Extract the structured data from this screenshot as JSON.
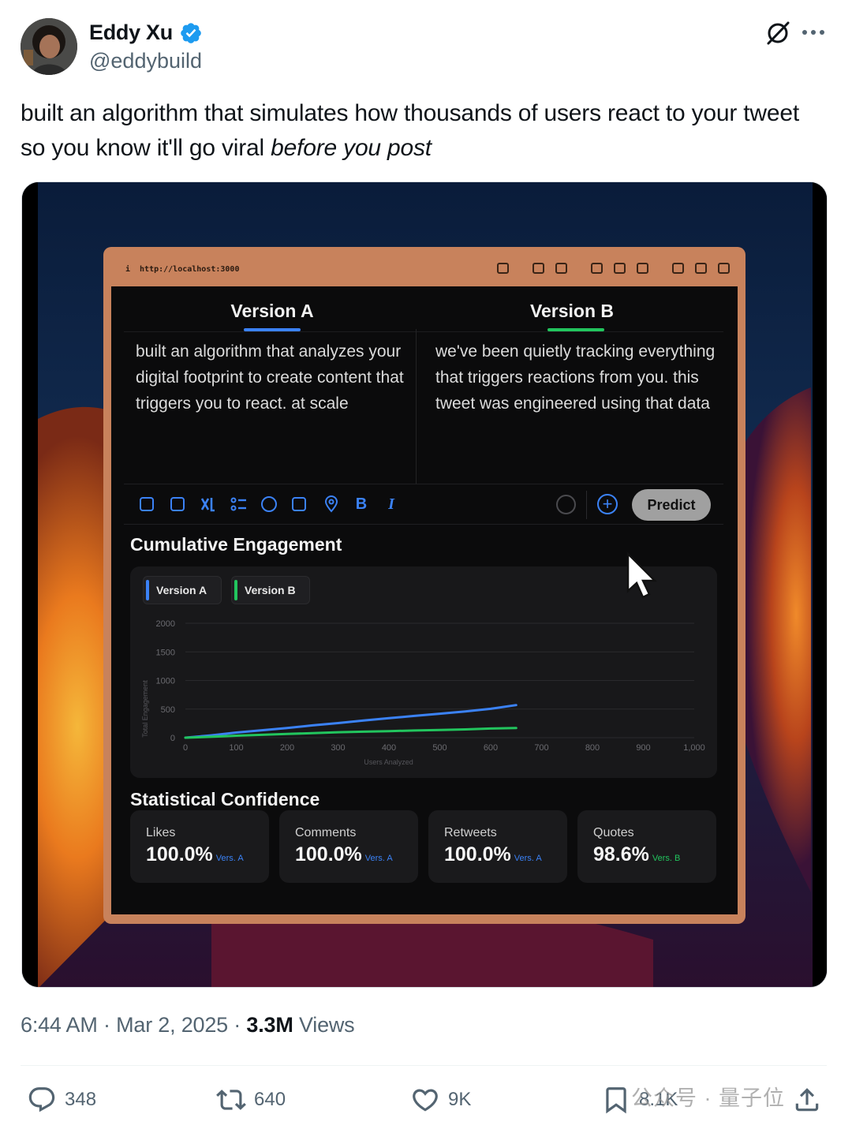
{
  "author": {
    "name": "Eddy Xu",
    "handle": "@eddybuild"
  },
  "tweet": {
    "text": "built an algorithm that simulates how thousands of users react to your tweet so you know it'll go viral ",
    "text_italic": "before you post"
  },
  "media": {
    "browser": {
      "info": "i",
      "url": "http://localhost:3000"
    },
    "tabs": {
      "a": "Version A",
      "b": "Version B"
    },
    "version_a_text": "built an algorithm that analyzes your digital footprint to create content that triggers you to react. at scale",
    "version_b_text": "we've been quietly tracking everything that triggers reactions from you. this tweet was engineered using that data",
    "toolbar": {
      "icons": [
        "image-icon",
        "gif-icon",
        "grok-icon",
        "list-icon",
        "emoji-icon",
        "schedule-icon",
        "location-icon",
        "bold-icon",
        "italic-icon"
      ],
      "bold": "B",
      "italic": "I",
      "add": "+",
      "predict_label": "Predict"
    },
    "engagement_title": "Cumulative Engagement",
    "confidence_title": "Statistical Confidence",
    "stats": [
      {
        "label": "Likes",
        "value": "100.0%",
        "version": "Vers. A"
      },
      {
        "label": "Comments",
        "value": "100.0%",
        "version": "Vers. A"
      },
      {
        "label": "Retweets",
        "value": "100.0%",
        "version": "Vers. A"
      },
      {
        "label": "Quotes",
        "value": "98.6%",
        "version": "Vers. B"
      }
    ]
  },
  "chart_data": {
    "type": "line",
    "title": "Cumulative Engagement",
    "xlabel": "Users Analyzed",
    "ylabel": "Total Engagement",
    "xlim": [
      0,
      1000
    ],
    "ylim": [
      0,
      2000
    ],
    "x_ticks": [
      "0",
      "100",
      "200",
      "300",
      "400",
      "500",
      "600",
      "700",
      "800",
      "900",
      "1,000"
    ],
    "y_ticks": [
      "0",
      "500",
      "1000",
      "1500",
      "2000"
    ],
    "grid": true,
    "legend_position": "top-left",
    "series": [
      {
        "name": "Version A",
        "color": "#3b82f6",
        "x": [
          0,
          50,
          100,
          150,
          200,
          250,
          300,
          350,
          400,
          450,
          500,
          550,
          600,
          650
        ],
        "y": [
          0,
          40,
          90,
          130,
          170,
          215,
          255,
          300,
          340,
          380,
          420,
          460,
          505,
          570
        ]
      },
      {
        "name": "Version B",
        "color": "#22c55e",
        "x": [
          0,
          50,
          100,
          150,
          200,
          250,
          300,
          350,
          400,
          450,
          500,
          550,
          600,
          650
        ],
        "y": [
          0,
          15,
          35,
          50,
          65,
          80,
          95,
          105,
          115,
          125,
          135,
          145,
          160,
          170
        ]
      }
    ]
  },
  "footer": {
    "time": "6:44 AM",
    "date": "Mar 2, 2025",
    "views_count": "3.3M",
    "views_label": "Views",
    "sep": "·",
    "replies": "348",
    "reposts": "640",
    "likes": "9K",
    "bookmarks": "8.1K",
    "watermark": "公众号 · 量子位"
  }
}
